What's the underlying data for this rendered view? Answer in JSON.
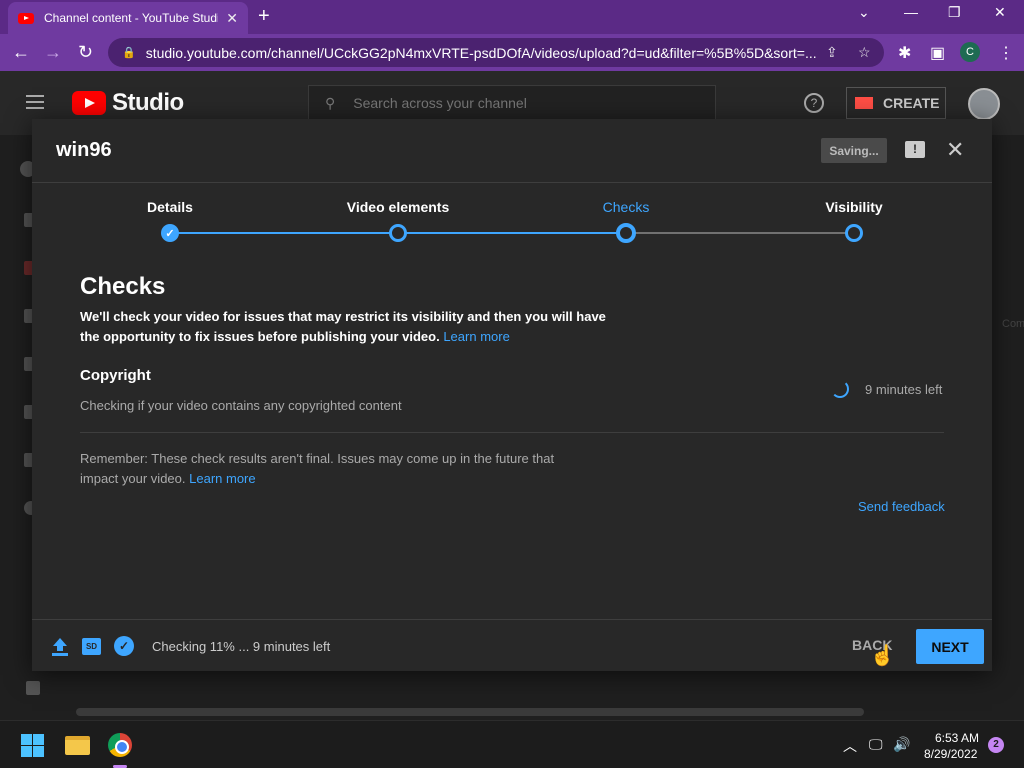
{
  "browser": {
    "tab_title": "Channel content - YouTube Studio",
    "tab_close": "✕",
    "new_tab": "+",
    "url": "studio.youtube.com/channel/UCckGG2pN4mxVRTE-psdDOfA/videos/upload?d=ud&filter=%5B%5D&sort=...",
    "window_controls": {
      "dropdown": "⌄",
      "minimize": "—",
      "restore": "❐",
      "close": "✕"
    },
    "nav": {
      "back": "←",
      "forward": "→",
      "reload": "↻"
    },
    "profile_initial": "C"
  },
  "studio_header": {
    "brand": "Studio",
    "search_placeholder": "Search across your channel",
    "help": "?",
    "create_label": "CREATE"
  },
  "right_ghost_text": "Com",
  "modal": {
    "title": "win96",
    "saving_label": "Saving...",
    "feedback_glyph": "!",
    "close_glyph": "✕",
    "steps": [
      {
        "label": "Details",
        "state": "done"
      },
      {
        "label": "Video elements",
        "state": "done"
      },
      {
        "label": "Checks",
        "state": "current"
      },
      {
        "label": "Visibility",
        "state": "upcoming"
      }
    ],
    "step_done_glyph": "✓",
    "checks_heading": "Checks",
    "checks_description": "We'll check your video for issues that may restrict its visibility and then you will have the opportunity to fix issues before publishing your video.",
    "learn_more": "Learn more",
    "copyright_heading": "Copyright",
    "copyright_sub": "Checking if your video contains any copyrighted content",
    "copyright_time_left": "9 minutes left",
    "remember_text": "Remember: These check results aren't final. Issues may come up in the future that impact your video.",
    "remember_learn_more": "Learn more",
    "send_feedback": "Send feedback",
    "footer": {
      "sd_badge": "SD",
      "check_glyph": "✓",
      "status": "Checking 11% ... 9 minutes left",
      "back_label": "BACK",
      "next_label": "NEXT"
    }
  },
  "taskbar": {
    "time": "6:53 AM",
    "date": "8/29/2022",
    "notifications": "2",
    "tray_chevron": "︿",
    "volume": "🔊"
  },
  "colors": {
    "accent": "#3ea6ff",
    "browser_frame": "#6f3aa0",
    "modal_bg": "#282828",
    "youtube_red": "#ff0000"
  }
}
